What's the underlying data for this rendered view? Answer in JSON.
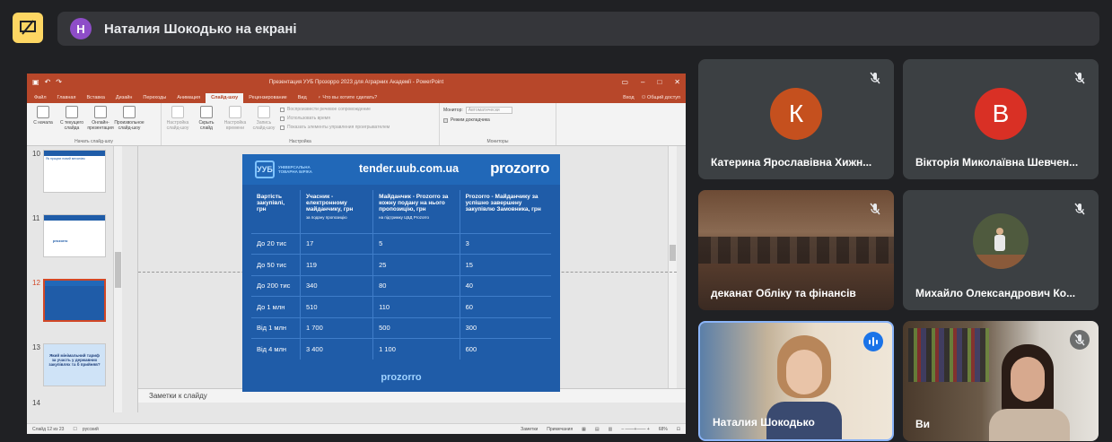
{
  "banner": {
    "avatar_letter": "Н",
    "text": "Наталия Шокодько на екрані"
  },
  "powerpoint": {
    "window_title": "Презентация УУБ Прозорро 2023 для Аграрних Академії - PowerPoint",
    "tabs": [
      "Файл",
      "Главная",
      "Вставка",
      "Дизайн",
      "Переходы",
      "Анимация",
      "Слайд-шоу",
      "Рецензирование",
      "Вид"
    ],
    "active_tab": "Слайд-шоу",
    "tell_me": "Что вы хотите сделать?",
    "sign_in": "Вход",
    "share": "Общий доступ",
    "ribbon": {
      "start_group": {
        "name": "Начать слайд-шоу",
        "buttons": [
          "С начала",
          "С текущего слайда",
          "Онлайн-презентация",
          "Произвольное слайд-шоу"
        ]
      },
      "setup_group": {
        "name": "Настройка",
        "buttons": [
          "Настройка слайд-шоу",
          "Скрыть слайд",
          "Настройка времени",
          "Запись слайд-шоу"
        ],
        "checks": [
          "Воспроизвести речевое сопровождение",
          "Использовать время",
          "Показать элементы управления проигрывателем"
        ]
      },
      "monitors_group": {
        "name": "Мониторы",
        "monitor_label": "Монитор:",
        "monitor_value": "Автоматически",
        "presenter_view": "Режим докладчика"
      }
    },
    "thumbnails": [
      {
        "num": "10",
        "text": "Як працює новий механізм"
      },
      {
        "num": "11",
        "text": "prozorro"
      },
      {
        "num": "12",
        "text": ""
      },
      {
        "num": "13",
        "text": "Який мінімальний тариф за участь у державних закупівлях та б прийняв?"
      },
      {
        "num": "14",
        "text": ""
      }
    ],
    "notes_placeholder": "Заметки к слайду",
    "status_left": "Слайд 12 из 23",
    "status_lang": "русский",
    "status_notes": "Заметки",
    "status_comments": "Примечания",
    "zoom": "68%"
  },
  "slide": {
    "logo_text": "УНІВЕРСАЛЬНА ТОВАРНА БІРЖА",
    "url": "tender.uub.com.ua",
    "brand": "prozorro",
    "footer_brand": "prozorro",
    "headers": [
      {
        "title": "Вартість закупівлі, грн",
        "sub": ""
      },
      {
        "title": "Учасник - електронному майданчику, грн",
        "sub": "за подану пропозицію"
      },
      {
        "title": "Майданчик - Prozorro за кожну подану на нього пропозицію, грн",
        "sub": "на підтримку ЦБД Prozorro"
      },
      {
        "title": "Prozorro - Майданчику за успішно завершену закупівлю Замовника, грн",
        "sub": ""
      }
    ],
    "rows": [
      [
        "До 20 тис",
        "17",
        "5",
        "3"
      ],
      [
        "До 50 тис",
        "119",
        "25",
        "15"
      ],
      [
        "До 200 тис",
        "340",
        "80",
        "40"
      ],
      [
        "До 1 млн",
        "510",
        "110",
        "60"
      ],
      [
        "Від 1 млн",
        "1 700",
        "500",
        "300"
      ],
      [
        "Від 4 млн",
        "3 400",
        "1 100",
        "600"
      ]
    ]
  },
  "participants": [
    {
      "name": "Катерина Ярославівна Хижн...",
      "letter": "К",
      "color": "#c5501e"
    },
    {
      "name": "Вікторія Миколаївна Шевчен...",
      "letter": "В",
      "color": "#d93025"
    },
    {
      "name": "деканат Обліку та фінансів"
    },
    {
      "name": "Михайло Олександрович Ко..."
    },
    {
      "name": "Наталия Шокодько"
    },
    {
      "name": "Ви"
    }
  ]
}
